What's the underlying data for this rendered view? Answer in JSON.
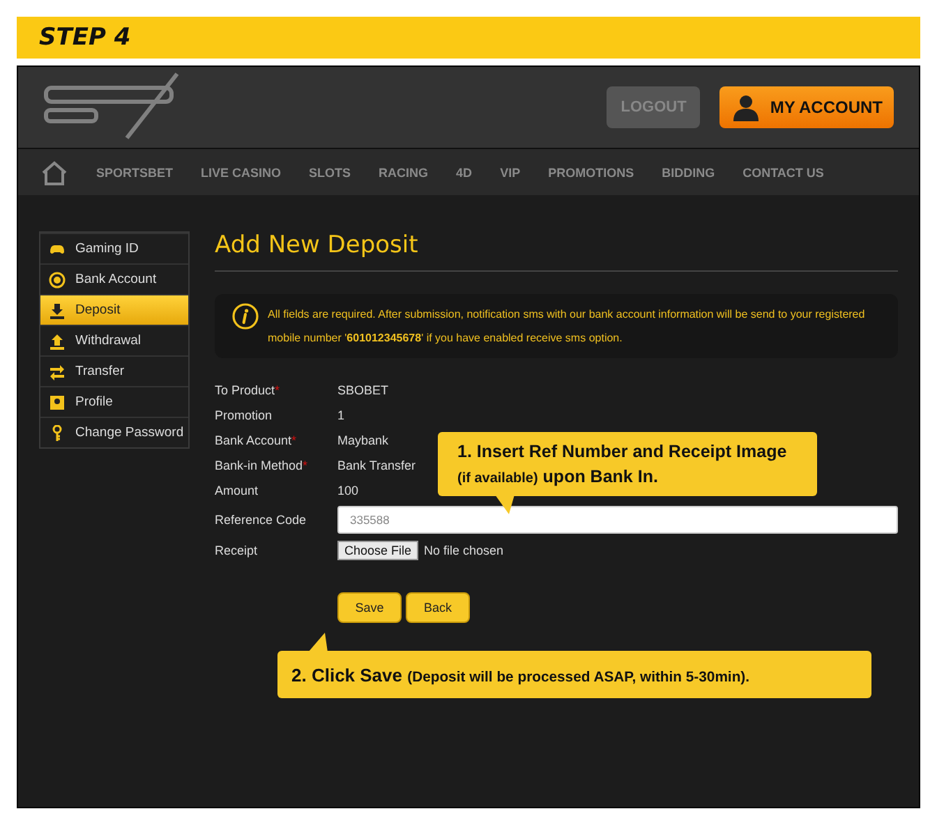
{
  "step_banner": {
    "title": "STEP 4"
  },
  "header": {
    "logout_button": "LOGOUT",
    "account_button": "MY ACCOUNT"
  },
  "nav": [
    "SPORTSBET",
    "LIVE CASINO",
    "SLOTS",
    "RACING",
    "4D",
    "VIP",
    "PROMOTIONS",
    "BIDDING",
    "CONTACT US"
  ],
  "sidebar": {
    "items": [
      {
        "label": "Gaming ID",
        "selected": false
      },
      {
        "label": "Bank Account",
        "selected": false
      },
      {
        "label": "Deposit",
        "selected": true
      },
      {
        "label": "Withdrawal",
        "selected": false
      },
      {
        "label": "Transfer",
        "selected": false
      },
      {
        "label": "Profile",
        "selected": false
      },
      {
        "label": "Change Password",
        "selected": false
      }
    ]
  },
  "main": {
    "title": "Add New Deposit",
    "notice": "All fields are required. After submission, notification sms with our bank account information will be send to your registered mobile number '**601012345678**' if you have enabled receive sms option.",
    "fields": [
      {
        "kind": "text",
        "label": "To Product",
        "required_mark": "*",
        "value": "SBOBET"
      },
      {
        "kind": "text",
        "label": "Promotion",
        "value": "1"
      },
      {
        "kind": "text",
        "label": "Bank Account",
        "required_mark": "*",
        "value": "Maybank"
      },
      {
        "kind": "text",
        "label": "Bank-in Method",
        "required_mark": "*",
        "value": "Bank Transfer"
      },
      {
        "kind": "text",
        "label": "Amount",
        "value": "100"
      },
      {
        "kind": "input",
        "label": "Reference Code",
        "placeholder": "335588"
      },
      {
        "kind": "file",
        "label": "Receipt",
        "button": "Choose File",
        "value": "No file chosen"
      }
    ],
    "buttons": [
      "Save",
      "Back"
    ]
  },
  "callouts": [
    {
      "parts": [
        {
          "kind": "main",
          "text": "1. Insert Ref Number and Receipt Image"
        },
        {
          "kind": "aside",
          "text": "(if available)"
        },
        {
          "kind": "main",
          "text": "upon Bank In."
        }
      ]
    },
    {
      "parts": [
        {
          "kind": "main",
          "text": "2. Click Save"
        },
        {
          "kind": "aside",
          "text": "(Deposit will be processed ASAP, within 5-30min)."
        }
      ]
    }
  ]
}
